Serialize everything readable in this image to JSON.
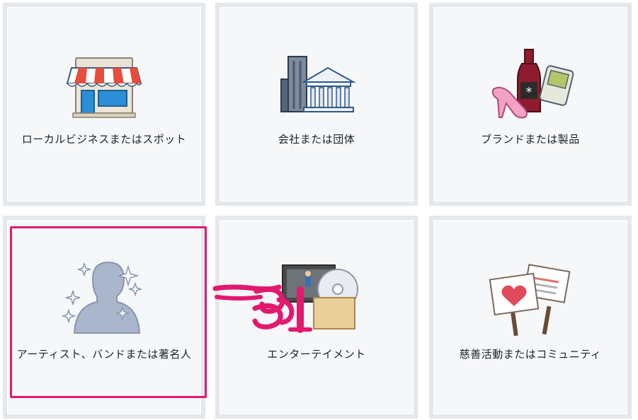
{
  "categories": [
    {
      "label": "ローカルビジネスまたはスポット",
      "icon": "storefront-icon"
    },
    {
      "label": "会社または団体",
      "icon": "company-buildings-icon"
    },
    {
      "label": "ブランドまたは製品",
      "icon": "brand-products-icon"
    },
    {
      "label": "アーティスト、バンドまたは著名人",
      "icon": "artist-silhouette-icon"
    },
    {
      "label": "エンターテイメント",
      "icon": "entertainment-media-icon"
    },
    {
      "label": "慈善活動またはコミュニティ",
      "icon": "community-signs-icon"
    }
  ],
  "colors": {
    "tile_bg": "#f6f7f9",
    "tile_border": "#e4e7eb",
    "highlight": "#e3186f"
  }
}
